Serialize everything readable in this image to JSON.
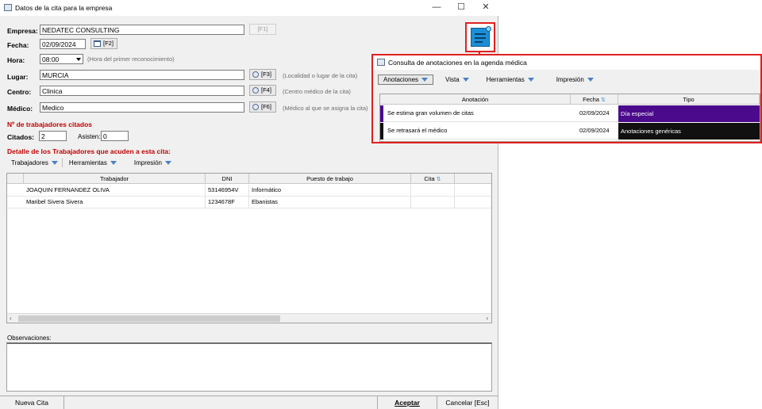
{
  "main": {
    "title": "Datos de la cita para la empresa",
    "win_min": "—",
    "win_max": "☐",
    "win_close": "✕",
    "empresa_label": "Empresa:",
    "empresa_value": "NEDATEC CONSULTING",
    "empresa_key": "[F1]",
    "fecha_label": "Fecha:",
    "fecha_value": "02/09/2024",
    "fecha_key": "[F2]",
    "hora_label": "Hora:",
    "hora_value": "08:00",
    "hora_hint": "(Hora del primer reconocimiento)",
    "lugar_label": "Lugar:",
    "lugar_value": "MURCIA",
    "lugar_key": "[F3]",
    "lugar_hint": "(Localidad o lugar de la cita)",
    "centro_label": "Centro:",
    "centro_value": "Clinica",
    "centro_key": "[F4]",
    "centro_hint": "(Centro médico de la cita)",
    "medico_label": "Médico:",
    "medico_value": "Medico",
    "medico_key": "[F6]",
    "medico_hint": "(Médico al que se asigna la cita)",
    "trabajadores_title": "Nº de trabajadores citados",
    "citados_label": "Citados:",
    "citados_value": "2",
    "asisten_label": "Asisten:",
    "asisten_value": "0",
    "detalle_title": "Detalle de los Trabajadores que acuden a esta cita:",
    "menu": [
      "Trabajadores",
      "Herramientas",
      "Impresión"
    ],
    "columns": [
      "Trabajador",
      "DNI",
      "Puesto de trabajo",
      "Cita"
    ],
    "rows": [
      {
        "trabajador": "JOAQUIN FERNANDEZ OLIVA",
        "dni": "53146954V",
        "puesto": "Informático"
      },
      {
        "trabajador": "Maribel Sivera Sivera",
        "dni": "1234678F",
        "puesto": "Ebanistas"
      }
    ],
    "observaciones_label": "Observaciones:",
    "nueva_cita": "Nueva Cita",
    "aceptar": "Aceptar",
    "cancelar": "Cancelar  [Esc]"
  },
  "overlay": {
    "title": "Consulta de anotaciones en la agenda médica",
    "menu": [
      "Anotaciones",
      "Vista",
      "Herramientas",
      "Impresión"
    ],
    "columns": [
      "Anotación",
      "Fecha",
      "Tipo"
    ],
    "rows": [
      {
        "anotacion": "Se estima gran volumen de citas",
        "fecha": "02/09/2024",
        "tipo": "Día especial",
        "color": "#4b0a8c"
      },
      {
        "anotacion": "Se retrasará el médico",
        "fecha": "02/09/2024",
        "tipo": "Anotaciones genéricas",
        "color": "#111111"
      }
    ]
  },
  "colors": {
    "highlight_border": "#e02020",
    "accent_blue": "#1a8fd8"
  },
  "icons": [
    "app-icon",
    "calendar-icon",
    "magnifier-icon",
    "dropdown-arrow-icon",
    "notes-icon",
    "sort-icon"
  ]
}
